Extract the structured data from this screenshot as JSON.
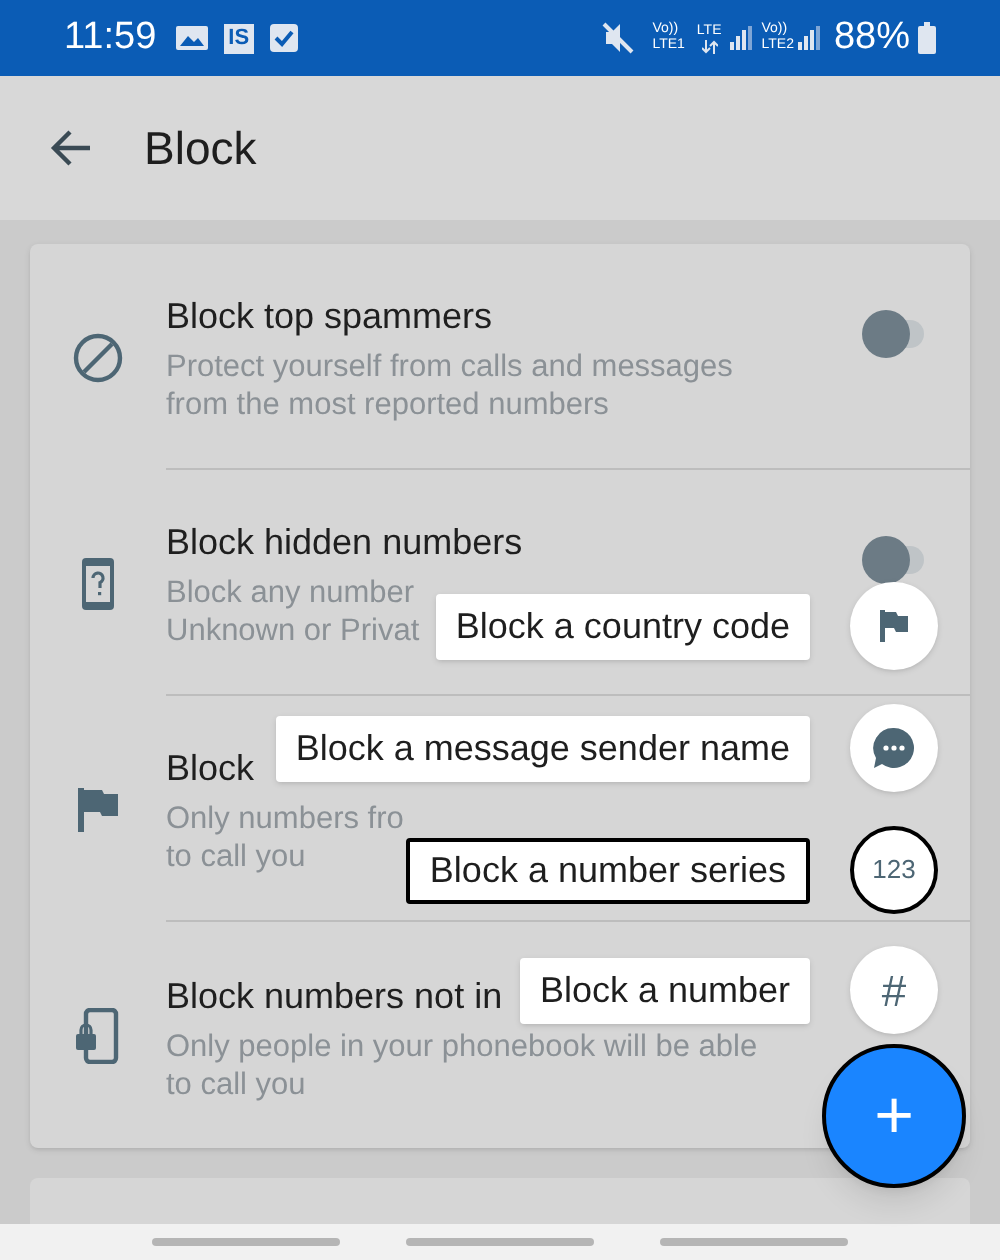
{
  "status_bar": {
    "time": "11:59",
    "notification_badge": "IS",
    "sim1": [
      "Vo))",
      "LTE1"
    ],
    "data": "LTE",
    "sim2": [
      "Vo))",
      "LTE2"
    ],
    "battery": "88%"
  },
  "header": {
    "title": "Block"
  },
  "settings": [
    {
      "kind": "ban",
      "title": "Block top spammers",
      "description": [
        "Protect yourself from calls and messages",
        "from the most reported numbers"
      ],
      "toggle": {
        "on": false
      }
    },
    {
      "kind": "hidden",
      "title": "Block hidden numbers",
      "description": [
        "Block any number",
        "Unknown or Privat"
      ],
      "toggle": {
        "on": false
      }
    },
    {
      "kind": "flag",
      "title": "Block",
      "description": [
        "Only numbers fro",
        "to call you"
      ]
    },
    {
      "kind": "lock",
      "title": "Block numbers not in",
      "description": [
        "Only people in your phonebook will be able",
        "to call you"
      ]
    }
  ],
  "speed_dial": [
    {
      "label": "Block a country code",
      "kind": "flag",
      "focused": false
    },
    {
      "label": "Block a message sender name",
      "kind": "message",
      "focused": false
    },
    {
      "label": "Block a number series",
      "kind": "text",
      "icon_text": "123",
      "focused": true
    },
    {
      "label": "Block a number",
      "kind": "text",
      "icon_text": "#",
      "focused": false
    }
  ],
  "fab": {
    "symbol": "+"
  }
}
